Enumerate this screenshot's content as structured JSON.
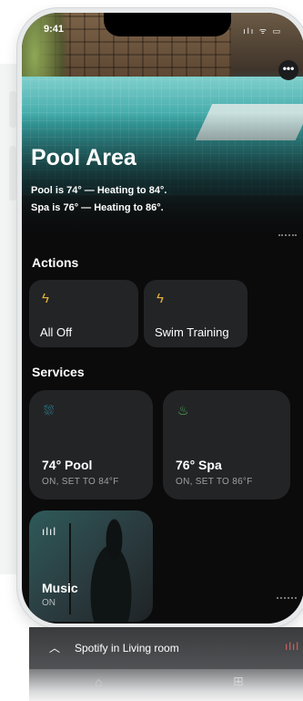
{
  "status_bar": {
    "time": "9:41",
    "icons": "ılı ᯤ ▭"
  },
  "hero": {
    "title": "Pool Area",
    "status_lines": [
      "Pool is 74° — Heating to 84°.",
      "Spa is 76° — Heating to 86°."
    ],
    "more_label": "•••"
  },
  "actions": {
    "title": "Actions",
    "items": [
      {
        "label": "All Off",
        "icon": "bolt-icon"
      },
      {
        "label": "Swim Training",
        "icon": "bolt-icon"
      }
    ]
  },
  "services": {
    "title": "Services",
    "items": [
      {
        "name": "74° Pool",
        "state": "ON, SET TO 84°F",
        "icon": "pool-icon",
        "icon_color": "#2fb6d6"
      },
      {
        "name": "76° Spa",
        "state": "ON, SET TO 86°F",
        "icon": "spa-icon",
        "icon_color": "#56b85a"
      }
    ],
    "music": {
      "name": "Music",
      "state": "ON",
      "icon": "bars-icon"
    }
  },
  "now_playing": {
    "text": "Spotify in Living room"
  },
  "colors": {
    "accent_bolt": "#e7b43a",
    "eq": "#e0625f",
    "tile_bg": "#232426"
  }
}
